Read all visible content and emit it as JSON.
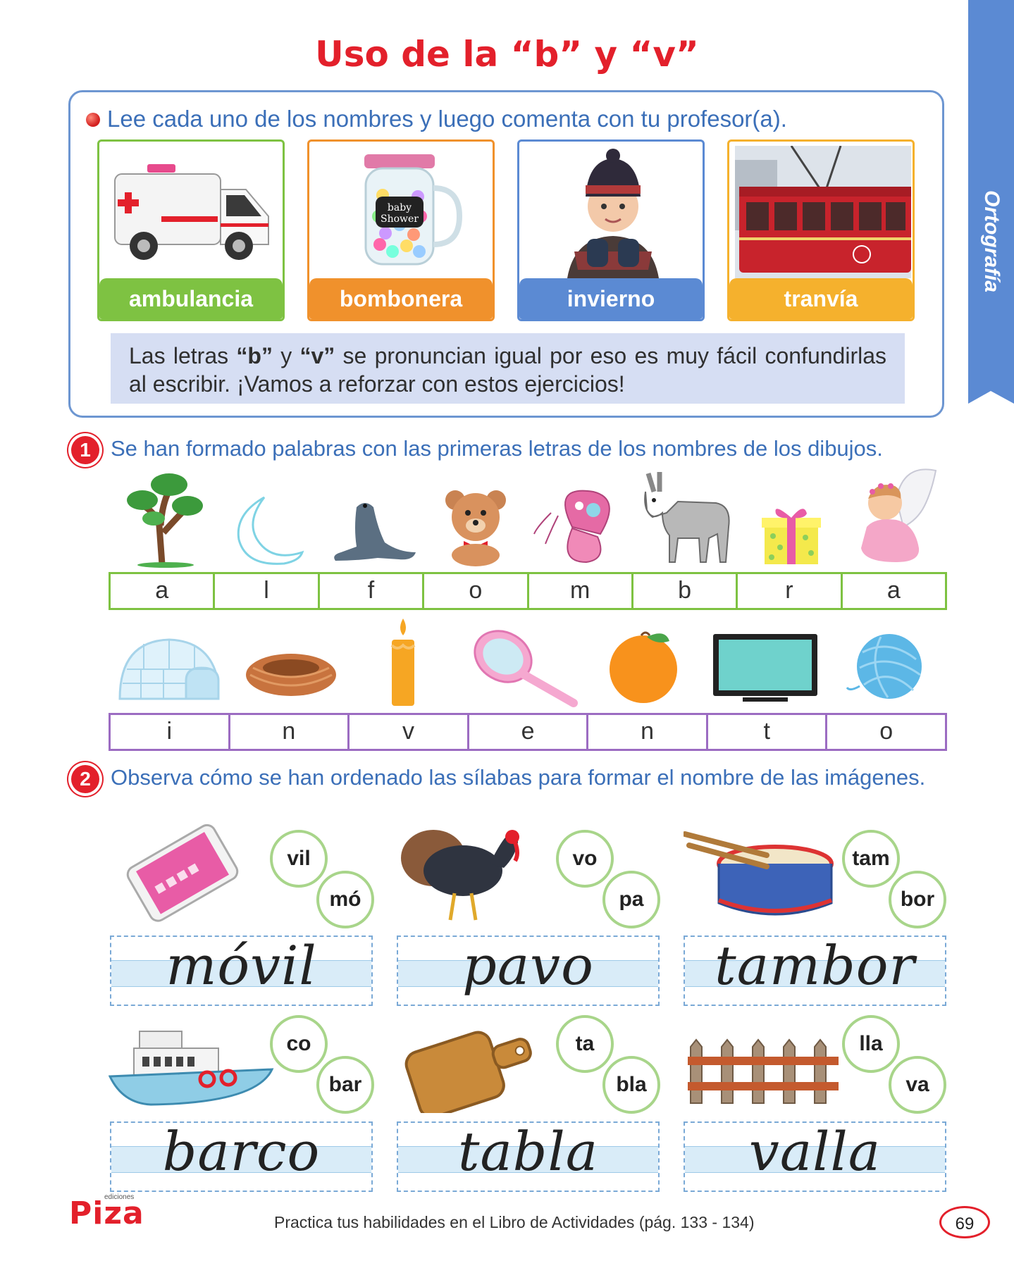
{
  "title": "Uso de la “b” y “v”",
  "side_tab": {
    "label": "Ortografía",
    "color": "#5b8ad3"
  },
  "intro": {
    "instruction": "Lee cada uno de los nombres y luego comenta con tu profesor(a).",
    "cards": [
      {
        "label": "ambulancia",
        "color": "#7ec242",
        "icon": "ambulance-icon"
      },
      {
        "label": "bombonera",
        "color": "#f0912c",
        "icon": "candy-jar-icon"
      },
      {
        "label": "invierno",
        "color": "#5b8ad3",
        "icon": "child-winter-icon"
      },
      {
        "label": "tranvía",
        "color": "#f5b12d",
        "icon": "tram-icon"
      }
    ],
    "note": {
      "part1": "Las letras ",
      "b": "“b”",
      "part2": " y ",
      "v": "“v”",
      "part3": " se pronuncian igual por eso es muy fácil confundirlas al escribir. ¡Vamos a reforzar con estos ejercicios!"
    }
  },
  "exercise1": {
    "number": "1",
    "instruction": "Se han formado palabras con las primeras letras de los nombres de los dibujos.",
    "row1": {
      "border_color": "#7ec242",
      "icons": [
        "tree-icon",
        "moon-icon",
        "seal-icon",
        "teddy-bear-icon",
        "butterfly-icon",
        "donkey-icon",
        "gift-icon",
        "angel-icon"
      ],
      "letters": [
        "a",
        "l",
        "f",
        "o",
        "m",
        "b",
        "r",
        "a"
      ]
    },
    "row2": {
      "border_color": "#9c6cc2",
      "icons": [
        "igloo-icon",
        "nest-icon",
        "candle-icon",
        "mirror-icon",
        "orange-icon",
        "television-icon",
        "yarn-ball-icon"
      ],
      "letters": [
        "i",
        "n",
        "v",
        "e",
        "n",
        "t",
        "o"
      ]
    }
  },
  "exercise2": {
    "number": "2",
    "instruction": "Observa cómo se han ordenado las sílabas para formar el nombre de las imágenes.",
    "items": [
      {
        "icon": "mobile-phone-icon",
        "syllables": [
          "vil",
          "mó"
        ],
        "word": "móvil"
      },
      {
        "icon": "turkey-icon",
        "syllables": [
          "vo",
          "pa"
        ],
        "word": "pavo"
      },
      {
        "icon": "drum-icon",
        "syllables": [
          "tam",
          "bor"
        ],
        "word": "tambor"
      },
      {
        "icon": "ship-icon",
        "syllables": [
          "co",
          "bar"
        ],
        "word": "barco"
      },
      {
        "icon": "cutting-board-icon",
        "syllables": [
          "ta",
          "bla"
        ],
        "word": "tabla"
      },
      {
        "icon": "fence-icon",
        "syllables": [
          "lla",
          "va"
        ],
        "word": "valla"
      }
    ]
  },
  "footer": {
    "logo": "Piza",
    "logo_sub": "ediciones",
    "text": "Practica tus habilidades en el Libro de Actividades (pág. 133 - 134)",
    "page_number": "69"
  }
}
